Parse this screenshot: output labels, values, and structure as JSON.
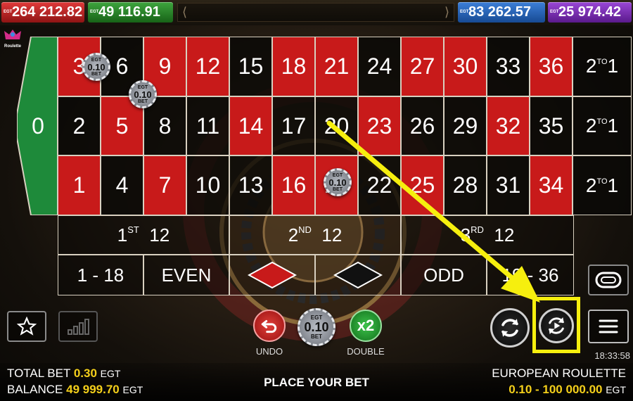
{
  "jackpots": {
    "red": {
      "label": "EGT",
      "value": "264 212.82",
      "color": "#c81a1a"
    },
    "green": {
      "label": "EGT",
      "value": "49 116.91",
      "color": "#2d8a2d"
    },
    "blue": {
      "label": "EGT",
      "value": "83 262.57",
      "color": "#2a64b8"
    },
    "purple": {
      "label": "EGT",
      "value": "25 974.42",
      "color": "#7a2db4"
    }
  },
  "logo_text": "Roulette",
  "table": {
    "zero": "0",
    "rows": [
      [
        {
          "n": "3",
          "c": "red"
        },
        {
          "n": "6",
          "c": "black"
        },
        {
          "n": "9",
          "c": "red"
        },
        {
          "n": "12",
          "c": "red"
        },
        {
          "n": "15",
          "c": "black"
        },
        {
          "n": "18",
          "c": "red"
        },
        {
          "n": "21",
          "c": "red"
        },
        {
          "n": "24",
          "c": "black"
        },
        {
          "n": "27",
          "c": "red"
        },
        {
          "n": "30",
          "c": "red"
        },
        {
          "n": "33",
          "c": "black"
        },
        {
          "n": "36",
          "c": "red"
        }
      ],
      [
        {
          "n": "2",
          "c": "black"
        },
        {
          "n": "5",
          "c": "red"
        },
        {
          "n": "8",
          "c": "black"
        },
        {
          "n": "11",
          "c": "black"
        },
        {
          "n": "14",
          "c": "red"
        },
        {
          "n": "17",
          "c": "black"
        },
        {
          "n": "20",
          "c": "black"
        },
        {
          "n": "23",
          "c": "red"
        },
        {
          "n": "26",
          "c": "black"
        },
        {
          "n": "29",
          "c": "black"
        },
        {
          "n": "32",
          "c": "red"
        },
        {
          "n": "35",
          "c": "black"
        }
      ],
      [
        {
          "n": "1",
          "c": "red"
        },
        {
          "n": "4",
          "c": "black"
        },
        {
          "n": "7",
          "c": "red"
        },
        {
          "n": "10",
          "c": "black"
        },
        {
          "n": "13",
          "c": "black"
        },
        {
          "n": "16",
          "c": "red"
        },
        {
          "n": "19",
          "c": "red"
        },
        {
          "n": "22",
          "c": "black"
        },
        {
          "n": "25",
          "c": "red"
        },
        {
          "n": "28",
          "c": "black"
        },
        {
          "n": "31",
          "c": "black"
        },
        {
          "n": "34",
          "c": "red"
        }
      ]
    ],
    "column_bet": {
      "main": "2",
      "sup": "TO",
      "end": "1"
    },
    "dozens": [
      {
        "num": "1",
        "sup": "ST",
        "val": "12"
      },
      {
        "num": "2",
        "sup": "ND",
        "val": "12"
      },
      {
        "num": "3",
        "sup": "RD",
        "val": "12"
      }
    ],
    "outside": {
      "low": "1 - 18",
      "even": "EVEN",
      "odd": "ODD",
      "high": "19 - 36"
    }
  },
  "chips": [
    {
      "brand": "EGT",
      "value": "0.10",
      "unit": "BET"
    },
    {
      "brand": "EGT",
      "value": "0.10",
      "unit": "BET"
    },
    {
      "brand": "EGT",
      "value": "0.10",
      "unit": "BET"
    }
  ],
  "controls": {
    "undo_label": "UNDO",
    "double_label": "DOUBLE",
    "double_icon_text": "x2",
    "selected_chip": {
      "brand": "EGT",
      "value": "0.10",
      "unit": "BET"
    },
    "clock": "18:33:58"
  },
  "footer": {
    "total_bet_label": "TOTAL BET",
    "total_bet_value": "0.30",
    "total_bet_currency": "EGT",
    "balance_label": "BALANCE",
    "balance_value": "49 999.70",
    "balance_currency": "EGT",
    "status": "PLACE YOUR BET",
    "game_name": "EUROPEAN ROULETTE",
    "limits": "0.10 - 100 000.00",
    "limits_currency": "EGT"
  },
  "colors": {
    "red": "#c81a1a",
    "green": "#1e8a3a",
    "highlight": "#f6ef0e",
    "accent_yellow": "#f4cf1a"
  }
}
